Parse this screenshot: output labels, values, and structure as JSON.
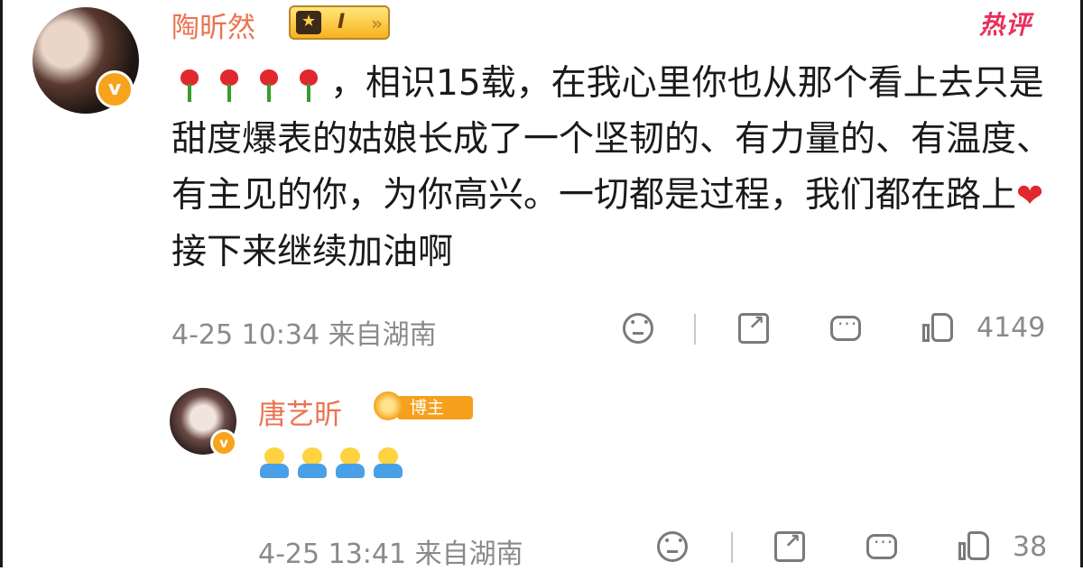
{
  "comment": {
    "username": "陶昕然",
    "level_badge": "I",
    "hot_label": "热评",
    "verified_mark": "v",
    "text": "，相识15载，在我心里你也从那个看上去只是甜度爆表的姑娘长成了一个坚韧的、有力量的、有温度、有主见的你，为你高兴。一切都是过程，我们都在路上",
    "text_after_heart": "接下来继续加油啊",
    "leading_emojis": [
      "rose",
      "rose",
      "rose",
      "rose"
    ],
    "inline_emoji": "heart",
    "date": "4-25 10:34",
    "location": "来自湖南",
    "like_count": "4149"
  },
  "reply": {
    "username": "唐艺昕",
    "badge_label": "博主",
    "verified_mark": "v",
    "emojis": [
      "hug",
      "hug",
      "hug",
      "hug"
    ],
    "date": "4-25 13:41",
    "location": "来自湖南",
    "like_count": "38"
  },
  "icons": {
    "dislike": "sad-face-icon",
    "share": "share-icon",
    "comment": "comment-icon",
    "like": "thumbs-up-icon"
  },
  "colors": {
    "username": "#eb7350",
    "hot": "#e8305b",
    "meta": "#8a8a8a",
    "verified": "#f7a31c"
  }
}
